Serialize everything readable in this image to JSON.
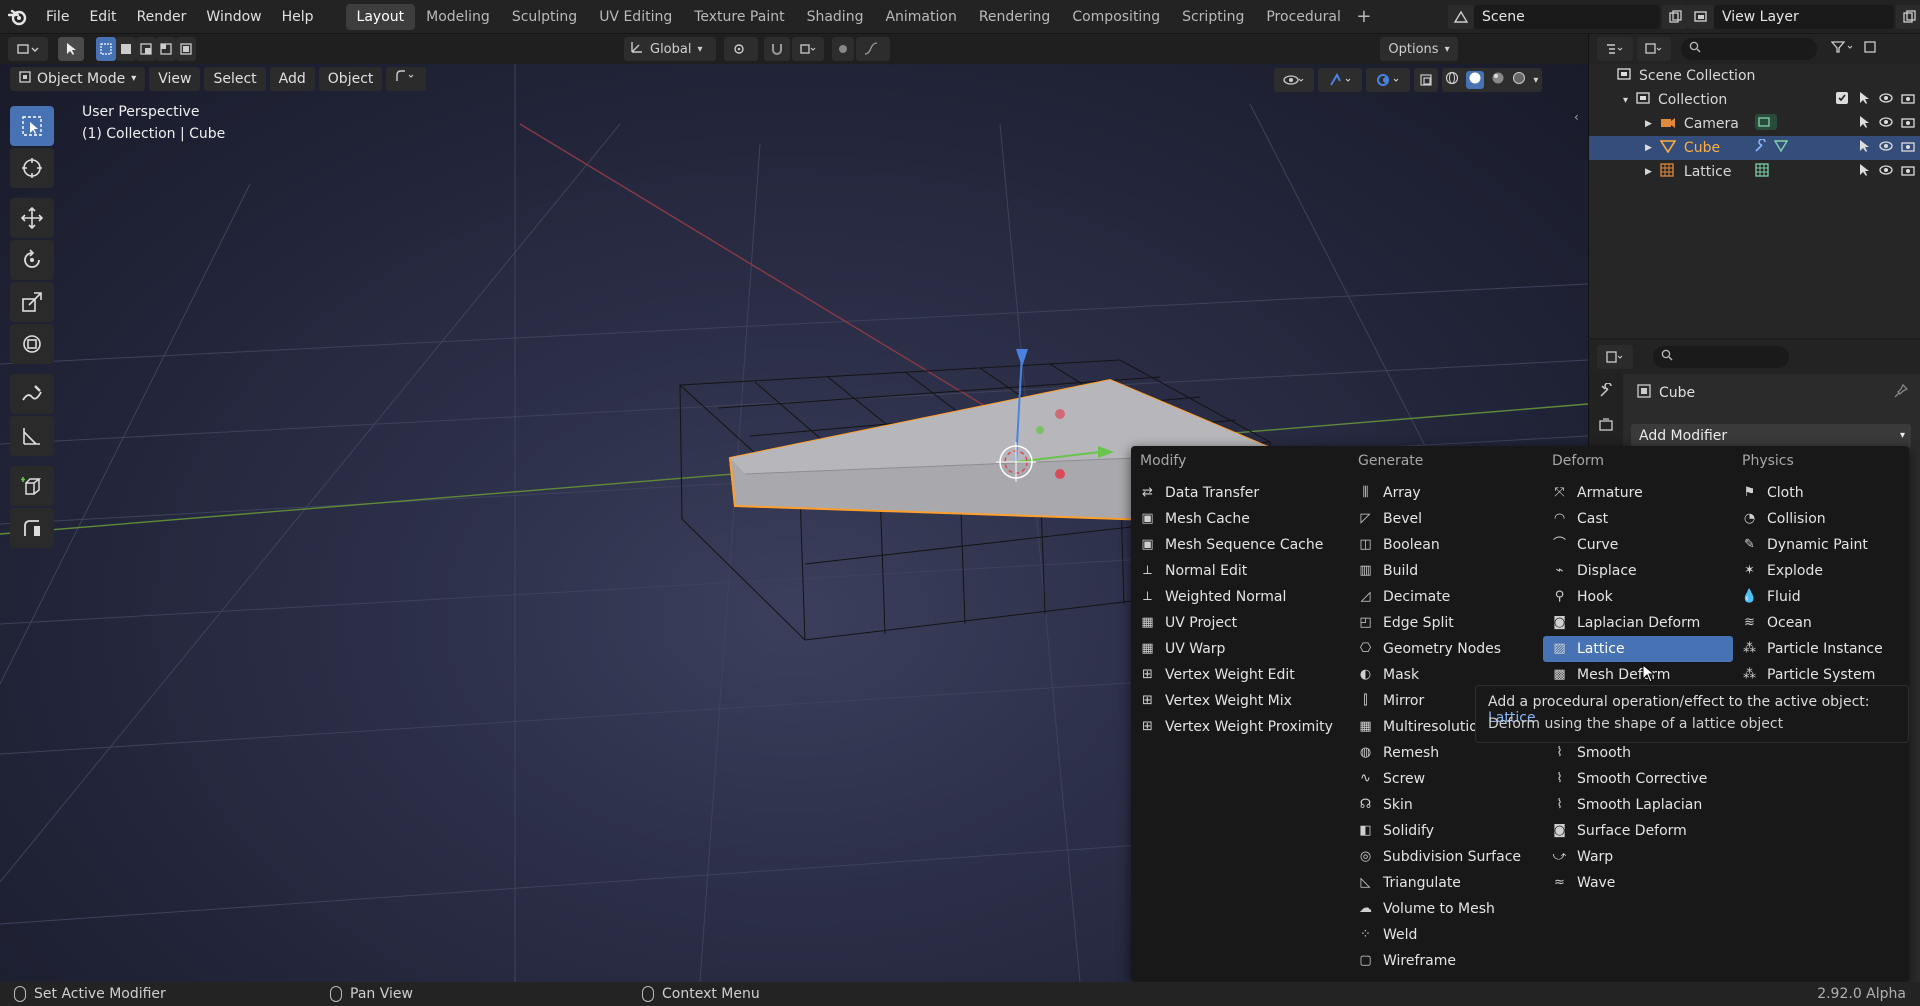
{
  "topbar": {
    "menus": [
      "File",
      "Edit",
      "Render",
      "Window",
      "Help"
    ],
    "workspaces": [
      "Layout",
      "Modeling",
      "Sculpting",
      "UV Editing",
      "Texture Paint",
      "Shading",
      "Animation",
      "Rendering",
      "Compositing",
      "Scripting",
      "Procedural"
    ],
    "active_workspace": "Layout",
    "add_tab": "+",
    "scene_name": "Scene",
    "view_layer": "View Layer"
  },
  "tool_header": {
    "orientation": "Global",
    "options": "Options"
  },
  "viewport": {
    "mode": "Object Mode",
    "menus": [
      "View",
      "Select",
      "Add",
      "Object"
    ],
    "perspective_label": "User Perspective",
    "context_label": "(1) Collection | Cube",
    "background_color": "#2c2f48",
    "selection_color": "#ff9f2e"
  },
  "outliner": {
    "rows": [
      {
        "label": "Scene Collection",
        "icon": "scene-collection-icon"
      },
      {
        "label": "Collection",
        "icon": "collection-icon"
      },
      {
        "label": "Camera",
        "icon": "camera-icon"
      },
      {
        "label": "Cube",
        "icon": "mesh-icon",
        "selected": true
      },
      {
        "label": "Lattice",
        "icon": "lattice-icon"
      }
    ]
  },
  "properties": {
    "object_name": "Cube",
    "add_modifier": "Add Modifier"
  },
  "modifier_menu": {
    "columns": [
      {
        "header": "Modify",
        "items": [
          {
            "label": "Data Transfer",
            "icon": "data-transfer-icon"
          },
          {
            "label": "Mesh Cache",
            "icon": "mesh-cache-icon"
          },
          {
            "label": "Mesh Sequence Cache",
            "icon": "mesh-sequence-cache-icon"
          },
          {
            "label": "Normal Edit",
            "icon": "normal-edit-icon"
          },
          {
            "label": "Weighted Normal",
            "icon": "weighted-normal-icon"
          },
          {
            "label": "UV Project",
            "icon": "uv-project-icon"
          },
          {
            "label": "UV Warp",
            "icon": "uv-warp-icon"
          },
          {
            "label": "Vertex Weight Edit",
            "icon": "vertex-weight-icon"
          },
          {
            "label": "Vertex Weight Mix",
            "icon": "vertex-weight-icon"
          },
          {
            "label": "Vertex Weight Proximity",
            "icon": "vertex-weight-icon"
          }
        ]
      },
      {
        "header": "Generate",
        "items": [
          {
            "label": "Array",
            "icon": "array-icon"
          },
          {
            "label": "Bevel",
            "icon": "bevel-icon"
          },
          {
            "label": "Boolean",
            "icon": "boolean-icon"
          },
          {
            "label": "Build",
            "icon": "build-icon"
          },
          {
            "label": "Decimate",
            "icon": "decimate-icon"
          },
          {
            "label": "Edge Split",
            "icon": "edge-split-icon"
          },
          {
            "label": "Geometry Nodes",
            "icon": "geometry-nodes-icon"
          },
          {
            "label": "Mask",
            "icon": "mask-icon"
          },
          {
            "label": "Mirror",
            "icon": "mirror-icon"
          },
          {
            "label": "Multiresolution",
            "icon": "multires-icon"
          },
          {
            "label": "Remesh",
            "icon": "remesh-icon"
          },
          {
            "label": "Screw",
            "icon": "screw-icon"
          },
          {
            "label": "Skin",
            "icon": "skin-icon"
          },
          {
            "label": "Solidify",
            "icon": "solidify-icon"
          },
          {
            "label": "Subdivision Surface",
            "icon": "subsurf-icon"
          },
          {
            "label": "Triangulate",
            "icon": "triangulate-icon"
          },
          {
            "label": "Volume to Mesh",
            "icon": "volume-to-mesh-icon"
          },
          {
            "label": "Weld",
            "icon": "weld-icon"
          },
          {
            "label": "Wireframe",
            "icon": "wireframe-icon"
          }
        ]
      },
      {
        "header": "Deform",
        "items": [
          {
            "label": "Armature",
            "icon": "armature-icon"
          },
          {
            "label": "Cast",
            "icon": "cast-icon"
          },
          {
            "label": "Curve",
            "icon": "curve-icon"
          },
          {
            "label": "Displace",
            "icon": "displace-icon"
          },
          {
            "label": "Hook",
            "icon": "hook-icon"
          },
          {
            "label": "Laplacian Deform",
            "icon": "laplacian-deform-icon"
          },
          {
            "label": "Lattice",
            "icon": "lattice-icon",
            "highlighted": true
          },
          {
            "label": "Mesh Deform",
            "icon": "mesh-deform-icon"
          },
          {
            "label": "",
            "icon": ""
          },
          {
            "label": "",
            "icon": ""
          },
          {
            "label": "Smooth",
            "icon": "smooth-icon"
          },
          {
            "label": "Smooth Corrective",
            "icon": "smooth-icon"
          },
          {
            "label": "Smooth Laplacian",
            "icon": "smooth-icon"
          },
          {
            "label": "Surface Deform",
            "icon": "surface-deform-icon"
          },
          {
            "label": "Warp",
            "icon": "warp-icon"
          },
          {
            "label": "Wave",
            "icon": "wave-icon"
          }
        ]
      },
      {
        "header": "Physics",
        "items": [
          {
            "label": "Cloth",
            "icon": "cloth-icon"
          },
          {
            "label": "Collision",
            "icon": "collision-icon"
          },
          {
            "label": "Dynamic Paint",
            "icon": "dynamic-paint-icon"
          },
          {
            "label": "Explode",
            "icon": "explode-icon"
          },
          {
            "label": "Fluid",
            "icon": "fluid-icon"
          },
          {
            "label": "Ocean",
            "icon": "ocean-icon"
          },
          {
            "label": "Particle Instance",
            "icon": "particle-instance-icon"
          },
          {
            "label": "Particle System",
            "icon": "particle-system-icon"
          }
        ]
      }
    ],
    "highlight_color": "#4772b3"
  },
  "tooltip": {
    "line1": "Add a procedural operation/effect to the active object:",
    "line1_accent": "Lattice",
    "line2": "Deform using the shape of a lattice object"
  },
  "statusbar": {
    "left": "Set Active Modifier",
    "middle": "Pan View",
    "right": "Context Menu",
    "version": "2.92.0 Alpha"
  }
}
